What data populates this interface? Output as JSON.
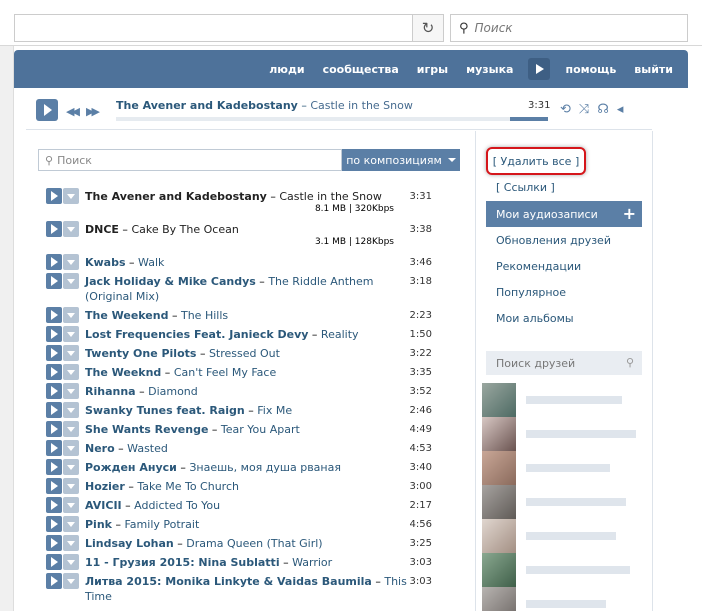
{
  "browser": {
    "search_placeholder": "Поиск"
  },
  "nav": {
    "items": [
      "люди",
      "сообщества",
      "игры",
      "музыка",
      "помощь",
      "выйти"
    ]
  },
  "player": {
    "artist": "The Avener and Kadebostany",
    "dash": " – ",
    "song": "Castle in the Snow",
    "time": "3:31"
  },
  "search": {
    "placeholder": "Поиск",
    "filter_label": "по композициям"
  },
  "tracks": [
    {
      "artist": "The Avener and Kadebostany",
      "title": "Castle in the Snow",
      "duration": "3:31",
      "meta": "8.1 MB | 320Kbps"
    },
    {
      "artist": "DNCE",
      "title": "Cake By The Ocean",
      "duration": "3:38",
      "meta": "3.1 MB | 128Kbps"
    },
    {
      "artist": "Kwabs",
      "title": "Walk",
      "duration": "3:46"
    },
    {
      "artist": "Jack Holiday & Mike Candys",
      "title": "The Riddle Anthem (Original Mix)",
      "duration": "3:18"
    },
    {
      "artist": "The Weekend",
      "title": "The Hills",
      "duration": "2:23"
    },
    {
      "artist": "Lost Frequencies Feat. Janieck Devy",
      "title": "Reality",
      "duration": "1:50"
    },
    {
      "artist": "Twenty One Pilots",
      "title": "Stressed Out",
      "duration": "3:22"
    },
    {
      "artist": "The Weeknd",
      "title": "Can't Feel My Face",
      "duration": "3:35"
    },
    {
      "artist": "Rihanna",
      "title": "Diamond",
      "duration": "3:52"
    },
    {
      "artist": "Swanky Tunes feat. Raign",
      "title": "Fix Me",
      "duration": "2:46"
    },
    {
      "artist": "She Wants Revenge",
      "title": "Tear You Apart",
      "duration": "4:49"
    },
    {
      "artist": "Nero",
      "title": "Wasted",
      "duration": "4:53"
    },
    {
      "artist": "Рожден Ануси",
      "title": "Знаешь, моя душа рваная",
      "duration": "3:40"
    },
    {
      "artist": "Hozier",
      "title": "Take Me To Church",
      "duration": "3:00"
    },
    {
      "artist": "AVICII",
      "title": "Addicted To You",
      "duration": "2:17"
    },
    {
      "artist": "Pink",
      "title": "Family Potrait",
      "duration": "4:56"
    },
    {
      "artist": "Lindsay Lohan",
      "title": "Drama Queen (That Girl)",
      "duration": "3:25"
    },
    {
      "artist": "11 - Грузия 2015: Nina Sublatti",
      "title": "Warrior",
      "duration": "3:03"
    },
    {
      "artist": "Литва 2015: Monika Linkyte & Vaidas Baumila",
      "title": "This Time",
      "duration": "3:03"
    }
  ],
  "sidebar": {
    "delete_all": "[ Удалить все ]",
    "links": "[ Ссылки ]",
    "menu": [
      "Мои аудиозаписи",
      "Обновления друзей",
      "Рекомендации",
      "Популярное",
      "Мои альбомы"
    ],
    "add_icon": "plus-icon",
    "friend_search_placeholder": "Поиск друзей"
  },
  "colors": {
    "header": "#4e729a",
    "accent": "#5b7fa6",
    "link": "#2b587a",
    "highlight_border": "#d5161b"
  }
}
